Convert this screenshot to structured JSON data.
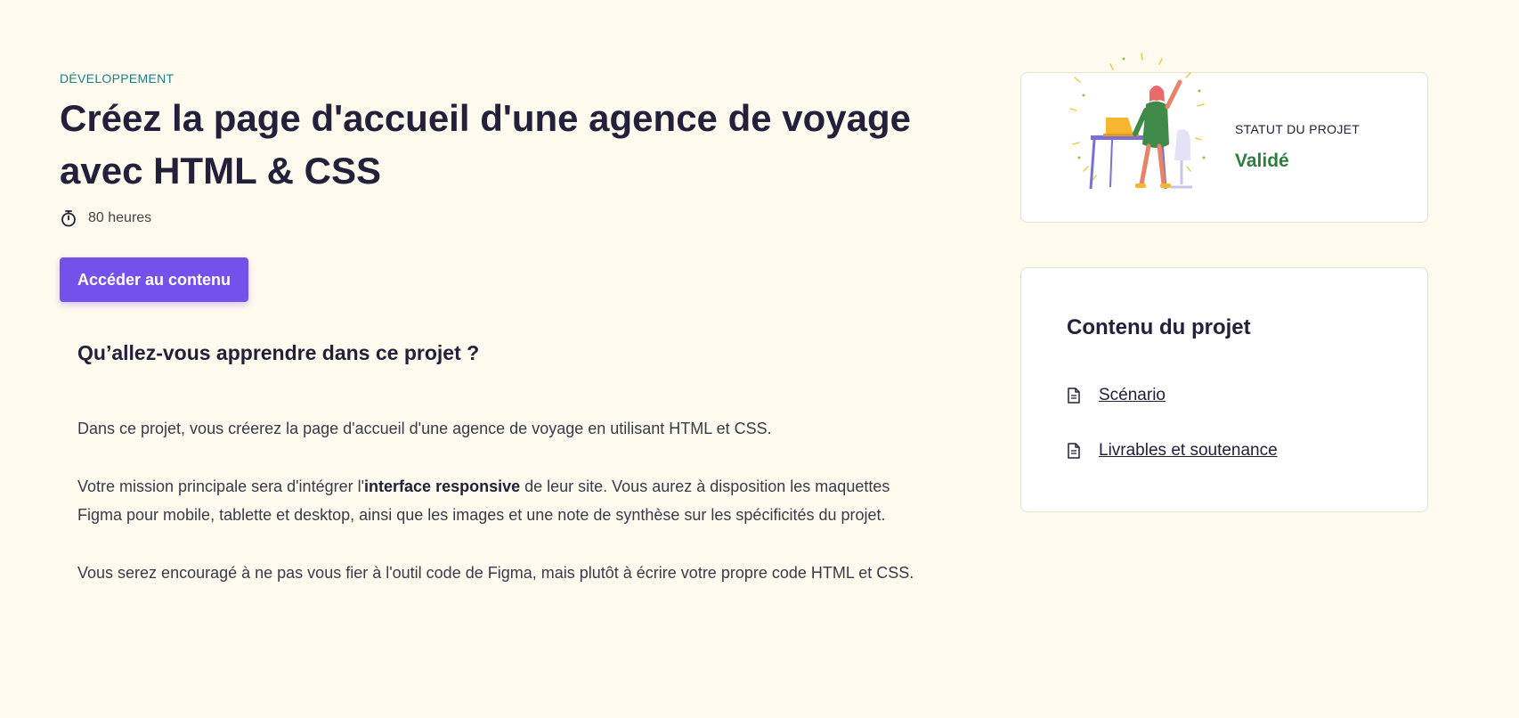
{
  "project": {
    "category": "DÉVELOPPEMENT",
    "title": "Créez la page d'accueil d'une agence de voyage avec HTML & CSS",
    "duration": "80 heures",
    "duration_icon": "stopwatch-icon",
    "cta_label": "Accéder au contenu"
  },
  "learn": {
    "heading": "Qu’allez-vous apprendre dans ce projet ?",
    "paragraph1": "Dans ce projet, vous créerez la page d'accueil d'une agence de voyage en utilisant HTML et CSS.",
    "paragraph2_before": "Votre mission principale sera d'intégrer l'",
    "paragraph2_bold": "interface responsive",
    "paragraph2_after": " de leur site. Vous aurez à disposition les maquettes Figma pour mobile, tablette et desktop, ainsi que les images et une note de synthèse sur les spécificités du projet.",
    "paragraph3": "Vous serez encouragé à ne pas vous fier à l'outil code de Figma, mais plutôt à écrire votre propre code HTML et CSS."
  },
  "status": {
    "label": "STATUT DU PROJET",
    "value": "Validé",
    "value_color": "#2e7d3e"
  },
  "contents": {
    "heading": "Contenu du projet",
    "items": [
      {
        "label": "Scénario",
        "icon": "document-icon"
      },
      {
        "label": "Livrables et soutenance",
        "icon": "document-icon"
      }
    ]
  },
  "colors": {
    "accent": "#7451eb",
    "category": "#1a7f8a",
    "background": "#fffaee"
  }
}
